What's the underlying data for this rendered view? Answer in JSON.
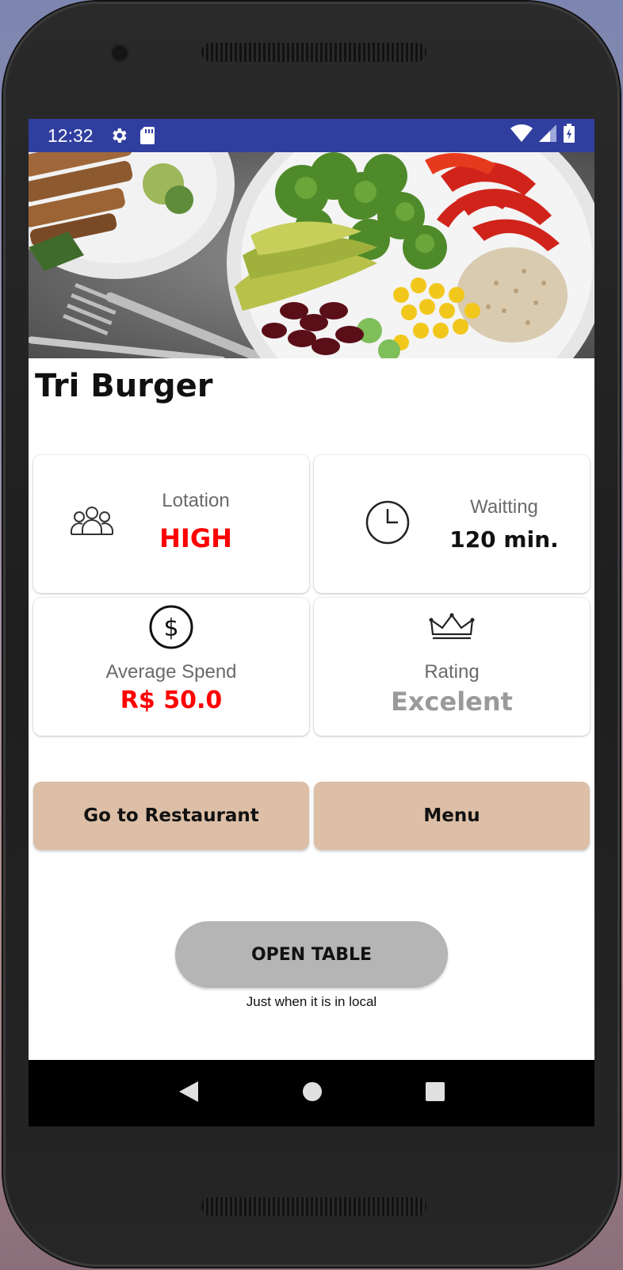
{
  "status_bar": {
    "time": "12:32",
    "icons": [
      "settings-gear-icon",
      "sd-card-icon",
      "wifi-icon",
      "signal-icon",
      "battery-icon"
    ],
    "background": "#303f9f"
  },
  "restaurant": {
    "name": "Tri Burger"
  },
  "cards": {
    "lotation": {
      "label": "Lotation",
      "value": "HIGH",
      "value_color": "#ff0000",
      "icon": "group-people-icon"
    },
    "waiting": {
      "label": "Waitting",
      "value": "120 min.",
      "value_color": "#111111",
      "icon": "clock-icon"
    },
    "average_spend": {
      "label": "Average Spend",
      "value": "R$ 50.0",
      "value_color": "#ff0000",
      "icon": "dollar-circle-icon"
    },
    "rating": {
      "label": "Rating",
      "value": "Excelent",
      "value_color": "#9a9a9a",
      "icon": "crown-icon"
    }
  },
  "actions": {
    "go_to_restaurant": "Go to Restaurant",
    "menu": "Menu",
    "button_color": "#dcbfa6"
  },
  "open_table": {
    "label": "OPEN TABLE",
    "note": "Just when it is in local"
  },
  "nav_bar": {
    "icons": [
      "back-icon",
      "home-icon",
      "recents-icon"
    ]
  }
}
